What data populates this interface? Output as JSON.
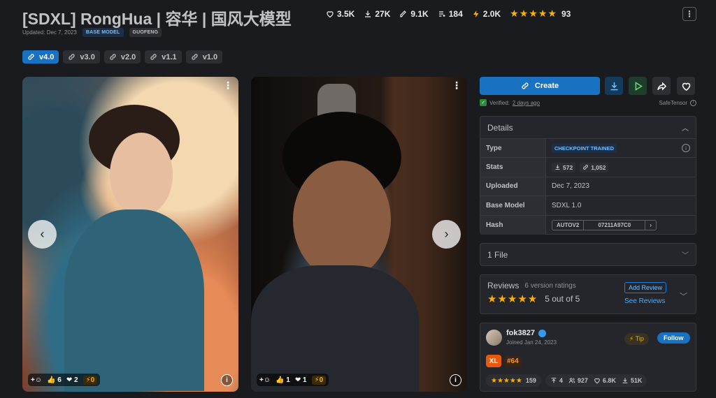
{
  "model": {
    "title": "[SDXL] RongHua | 容华 | 国风大模型",
    "updated": "Updated: Dec 7, 2023",
    "badges": [
      "BASE MODEL",
      "GUOFENG"
    ]
  },
  "header_stats": {
    "likes": "3.5K",
    "downloads": "27K",
    "generations": "9.1K",
    "collections": "184",
    "buzz": "2.0K",
    "rating_count": "93",
    "stars": 5
  },
  "versions": [
    {
      "label": "v4.0",
      "active": true
    },
    {
      "label": "v3.0",
      "active": false
    },
    {
      "label": "v2.0",
      "active": false
    },
    {
      "label": "v1.1",
      "active": false
    },
    {
      "label": "v1.0",
      "active": false
    }
  ],
  "gallery": [
    {
      "like": "6",
      "heart": "2",
      "buzz": "0"
    },
    {
      "like": "1",
      "heart": "1",
      "buzz": "0"
    }
  ],
  "actions": {
    "create_label": "Create",
    "verified_prefix": "Verified:",
    "verified_time": "2 days ago",
    "file_format": "SafeTensor"
  },
  "details": {
    "header": "Details",
    "rows": {
      "type_label": "Type",
      "type_value": "CHECKPOINT TRAINED",
      "stats_label": "Stats",
      "stats_downloads": "572",
      "stats_generations": "1,052",
      "uploaded_label": "Uploaded",
      "uploaded_value": "Dec 7, 2023",
      "base_label": "Base Model",
      "base_value": "SDXL 1.0",
      "hash_label": "Hash",
      "hash_algo": "AUTOV2",
      "hash_value": "07211A97C0"
    }
  },
  "files": {
    "label": "1 File"
  },
  "reviews": {
    "title": "Reviews",
    "count_text": "6 version ratings",
    "score_text": "5 out of 5",
    "stars": 5,
    "add_label": "Add Review",
    "see_label": "See Reviews"
  },
  "creator": {
    "username": "fok3827",
    "joined": "Joined Jan 24, 2023",
    "tip_label": "Tip",
    "follow_label": "Follow",
    "rank": "#64",
    "xl_badge": "XL",
    "rating_count": "159",
    "uploads": "4",
    "followers": "927",
    "likes": "6.8K",
    "downloads": "51K"
  },
  "colors": {
    "accent": "#1971c2",
    "star": "#fab005",
    "bg": "#1a1b1e",
    "panel": "#25262b"
  }
}
